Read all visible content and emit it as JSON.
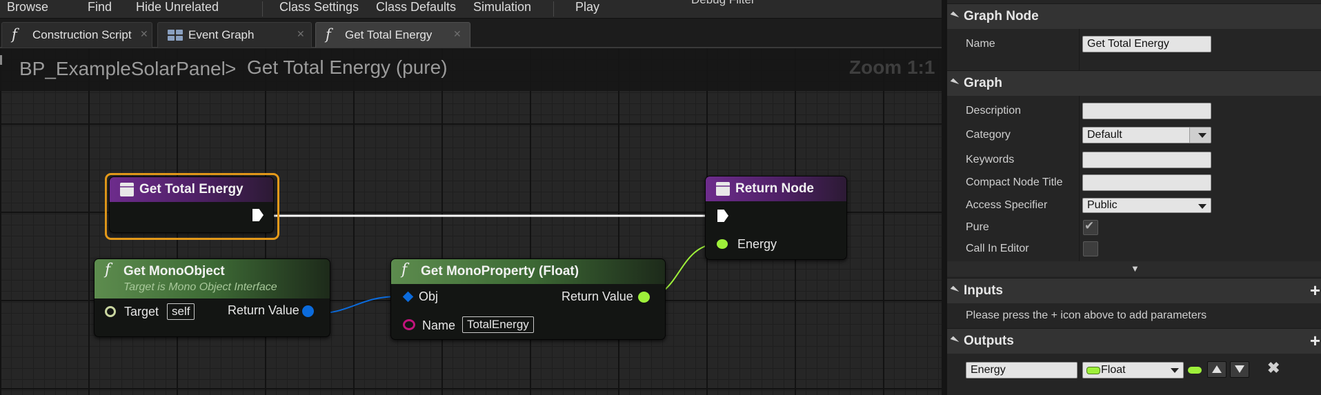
{
  "toolbar": {
    "items": [
      "Browse",
      "Find",
      "Hide Unrelated",
      "Class Settings",
      "Class Defaults",
      "Simulation",
      "Play"
    ],
    "debug_filter": "Debug Filter"
  },
  "tabs": [
    {
      "label": "Construction Script",
      "icon": "function-icon"
    },
    {
      "label": "Event Graph",
      "icon": "event-graph-icon"
    },
    {
      "label": "Get Total Energy",
      "icon": "function-icon"
    }
  ],
  "graph": {
    "breadcrumb": [
      "BP_ExampleSolarPanel",
      "Get Total Energy (pure)"
    ],
    "zoom": "Zoom 1:1",
    "nodes": {
      "entry": {
        "title": "Get Total Energy"
      },
      "return": {
        "title": "Return Node",
        "pin": "Energy"
      },
      "get_mono_object": {
        "title": "Get MonoObject",
        "subtitle": "Target is Mono Object Interface",
        "target_label": "Target",
        "target_value": "self",
        "return_label": "Return Value"
      },
      "get_mono_property": {
        "title": "Get MonoProperty (Float)",
        "obj_label": "Obj",
        "name_label": "Name",
        "name_value": "TotalEnergy",
        "return_label": "Return Value"
      }
    },
    "colors": {
      "exec": "#ffffff",
      "float_pin": "#9ef03a",
      "object_pin": "#0b6bdc",
      "name_pin": "#c2137c",
      "selection": "#e59a1a"
    }
  },
  "details": {
    "graph_node": {
      "header": "Graph Node",
      "name_label": "Name",
      "name_value": "Get Total Energy"
    },
    "graph": {
      "header": "Graph",
      "description_label": "Description",
      "description_value": "",
      "category_label": "Category",
      "category_value": "Default",
      "keywords_label": "Keywords",
      "keywords_value": "",
      "compact_label": "Compact Node Title",
      "compact_value": "",
      "access_label": "Access Specifier",
      "access_value": "Public",
      "pure_label": "Pure",
      "pure_checked": true,
      "call_in_editor_label": "Call In Editor",
      "call_in_editor_checked": false
    },
    "inputs": {
      "header": "Inputs",
      "hint": "Please press the + icon above to add parameters"
    },
    "outputs": {
      "header": "Outputs",
      "param_name": "Energy",
      "param_type": "Float"
    }
  }
}
